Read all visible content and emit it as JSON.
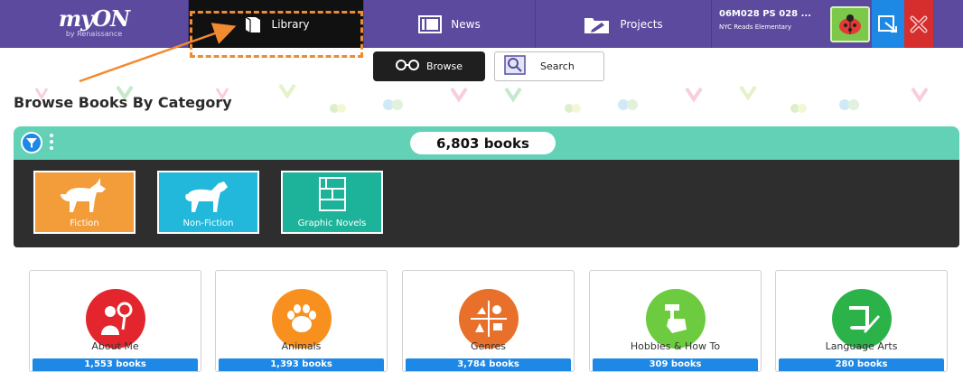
{
  "nav": {
    "brand": "myON",
    "brand_sub": "by Renaissance",
    "tabs": [
      {
        "label": "Library",
        "icon": "book-icon",
        "active": true
      },
      {
        "label": "News",
        "icon": "newspaper-icon",
        "active": false
      },
      {
        "label": "Projects",
        "icon": "folder-edit-icon",
        "active": false
      }
    ],
    "user": {
      "line1": "06M028 PS 028 ...",
      "line2": "NYC Reads Elementary"
    }
  },
  "toolbar": {
    "browse_label": "Browse",
    "search_label": "Search"
  },
  "page": {
    "heading": "Browse Books By Category",
    "book_count": "6,803 books"
  },
  "categories": [
    {
      "label": "Fiction",
      "color": "#f39c3a",
      "icon": "unicorn-icon"
    },
    {
      "label": "Non-Fiction",
      "color": "#22b8dc",
      "icon": "horse-icon"
    },
    {
      "label": "Graphic Novels",
      "color": "#1db39a",
      "icon": "comic-panels-icon"
    }
  ],
  "subjects": [
    {
      "name": "About Me",
      "books": "1,553 books",
      "color": "#e3262d",
      "icon": "person-mirror-icon"
    },
    {
      "name": "Animals",
      "books": "1,393 books",
      "color": "#f7901e",
      "icon": "paw-icon"
    },
    {
      "name": "Genres",
      "books": "3,784 books",
      "color": "#e8702a",
      "icon": "genres-collage-icon"
    },
    {
      "name": "Hobbies & How To",
      "books": "309 books",
      "color": "#6ccb3e",
      "icon": "hand-hammer-icon"
    },
    {
      "name": "Language Arts",
      "books": "280 books",
      "color": "#2bb34a",
      "icon": "scroll-quill-icon"
    }
  ],
  "colors": {
    "nav_bg": "#5b4a9e",
    "highlight": "#f28a2e",
    "teal": "#62d1b6",
    "badge_blue": "#1d88e5"
  }
}
